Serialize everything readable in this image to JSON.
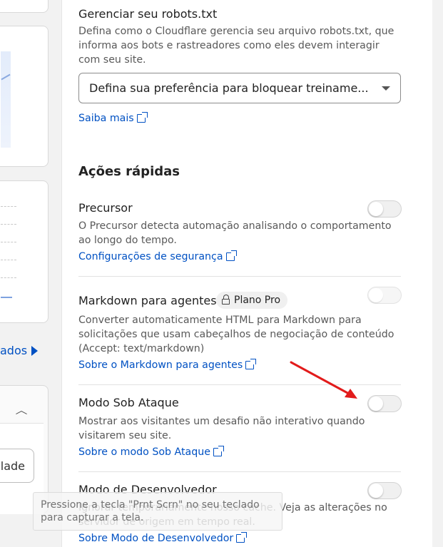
{
  "left": {
    "link_label": "ados",
    "button_label": "lade"
  },
  "robots": {
    "title": "Gerenciar seu robots.txt",
    "description": "Defina como o Cloudflare gerencia seu arquivo robots.txt, que informa aos bots e rastreadores como eles devem interagir com seu site.",
    "select_value": "Defina sua preferência para bloquear treiname...",
    "link": "Saiba mais"
  },
  "quick_actions": {
    "title": "Ações rápidas",
    "items": [
      {
        "title": "Precursor",
        "description": "O Precursor detecta automação analisando o comportamento ao longo do tempo.",
        "link": "Configurações de segurança",
        "enabled": false
      },
      {
        "title": "Markdown para agentes",
        "badge": "Plano Pro",
        "description": "Converter automaticamente HTML para Markdown para solicitações que usam cabeçalhos de negociação de conteúdo (Accept: text/markdown)",
        "link": "Sobre o Markdown para agentes",
        "enabled": false
      },
      {
        "title": "Modo Sob Ataque",
        "description": "Mostrar aos visitantes um desafio não interativo quando visitarem seu site.",
        "link": "Sobre o modo Sob Ataque",
        "enabled": false
      },
      {
        "title": "Modo de Desenvolvedor",
        "description": "Ignorar temporariamente nosso cache. Veja as alterações no servidor de origem em tempo real.",
        "link": "Sobre Modo de Desenvolvedor",
        "enabled": false
      }
    ]
  },
  "tooltip": {
    "text": "Pressione a tecla \"Prnt Scrn\" no seu teclado para capturar a tela."
  },
  "colors": {
    "link": "#0051c3",
    "annotation_arrow": "#e21b1b"
  }
}
